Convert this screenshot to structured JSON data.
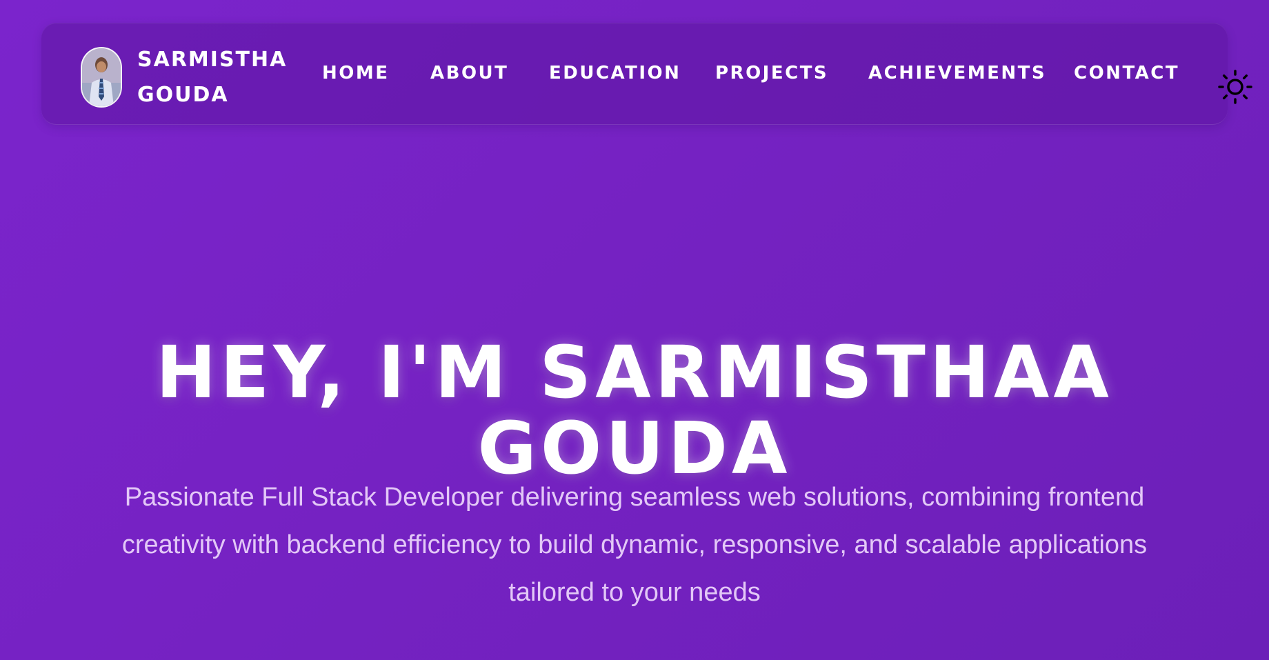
{
  "brand": {
    "name_line1": "SARMISTHA",
    "name_line2": "GOUDA",
    "avatar_alt": "profile photo"
  },
  "nav": {
    "items": [
      {
        "label": "HOME"
      },
      {
        "label": "ABOUT"
      },
      {
        "label": "EDUCATION"
      },
      {
        "label": "PROJECTS"
      },
      {
        "label": "ACHIEVEMENTS"
      },
      {
        "label": "CONTACT"
      }
    ],
    "theme_toggle_icon": "sun-icon"
  },
  "hero": {
    "title": "HEY, I'M SARMISTHAA GOUDA",
    "subtitle": "Passionate Full Stack Developer delivering seamless web solutions, combining frontend creativity with backend efficiency to build dynamic, responsive, and scalable applications tailored to your needs"
  },
  "colors": {
    "background": "#7522c2",
    "navbar": "#6a1fb5",
    "text_primary": "#ffffff",
    "text_subtitle": "#e3c8f7"
  }
}
